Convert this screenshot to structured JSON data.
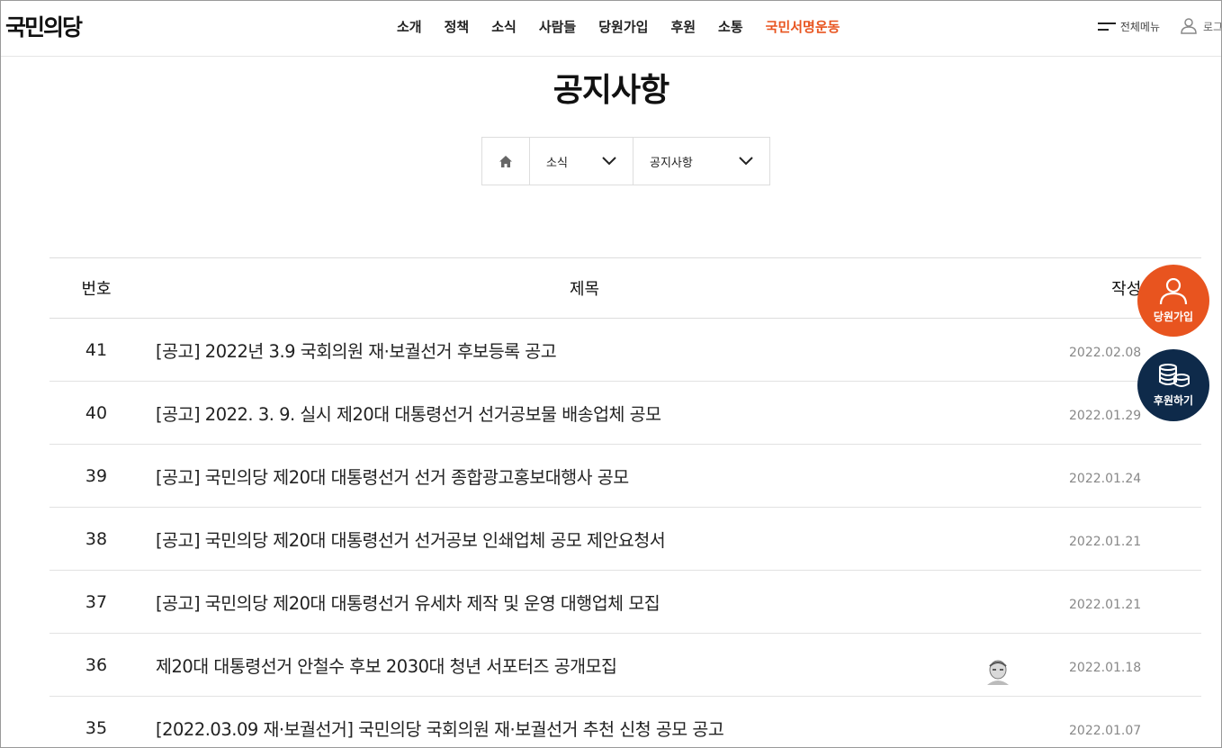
{
  "header": {
    "logo": "국민의당",
    "nav": [
      {
        "label": "소개",
        "accent": false
      },
      {
        "label": "정책",
        "accent": false
      },
      {
        "label": "소식",
        "accent": false
      },
      {
        "label": "사람들",
        "accent": false
      },
      {
        "label": "당원가입",
        "accent": false
      },
      {
        "label": "후원",
        "accent": false
      },
      {
        "label": "소통",
        "accent": false
      },
      {
        "label": "국민서명운동",
        "accent": true
      }
    ],
    "all_menu_label": "전체메뉴",
    "login_label": "로그인",
    "all_menu_icon": "hamburger-icon",
    "login_icon": "user-icon"
  },
  "page": {
    "title": "공지사항"
  },
  "breadcrumb": {
    "home_icon": "home-icon",
    "select1": "소식",
    "select2": "공지사항"
  },
  "table": {
    "headers": {
      "no": "번호",
      "title": "제목",
      "date": "작성일"
    },
    "rows": [
      {
        "no": "41",
        "title": "[공고] 2022년 3.9 국회의원 재·보궐선거 후보등록 공고",
        "date": "2022.02.08"
      },
      {
        "no": "40",
        "title": "[공고] 2022. 3. 9. 실시 제20대 대통령선거 선거공보물 배송업체 공모",
        "date": "2022.01.29"
      },
      {
        "no": "39",
        "title": "[공고] 국민의당 제20대 대통령선거 선거 종합광고홍보대행사 공모",
        "date": "2022.01.24"
      },
      {
        "no": "38",
        "title": "[공고] 국민의당 제20대 대통령선거 선거공보 인쇄업체 공모 제안요청서",
        "date": "2022.01.21"
      },
      {
        "no": "37",
        "title": "[공고] 국민의당 제20대 대통령선거 유세차 제작 및 운영 대행업체 모집",
        "date": "2022.01.21"
      },
      {
        "no": "36",
        "title": "제20대 대통령선거 안철수 후보 2030대 청년 서포터즈 공개모집",
        "date": "2022.01.18"
      },
      {
        "no": "35",
        "title": "[2022.03.09 재·보궐선거] 국민의당 국회의원 재·보궐선거 추천 신청 공모 공고",
        "date": "2022.01.07"
      }
    ]
  },
  "floating": {
    "join_label": "당원가입",
    "donate_label": "후원하기"
  },
  "colors": {
    "accent": "#e8541f",
    "navy": "#0e2a4a"
  }
}
